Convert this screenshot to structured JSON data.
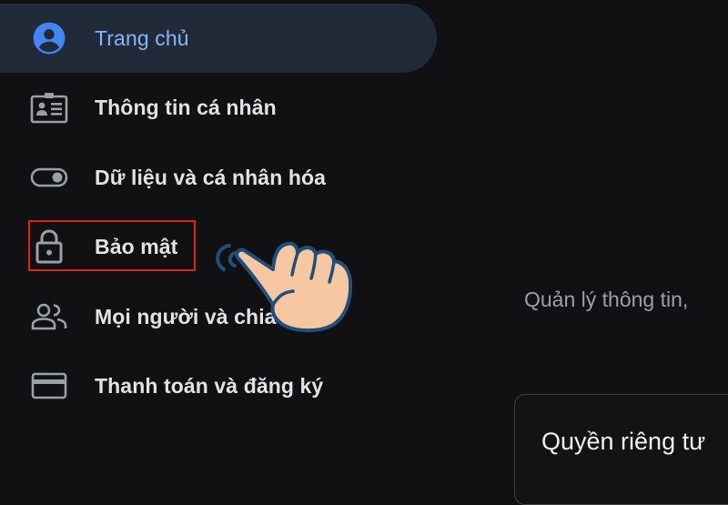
{
  "sidebar": {
    "items": [
      {
        "label": "Trang chủ",
        "icon": "account-circle-icon",
        "active": true
      },
      {
        "label": "Thông tin cá nhân",
        "icon": "id-card-icon",
        "active": false
      },
      {
        "label": "Dữ liệu và cá nhân hóa",
        "icon": "toggle-icon",
        "active": false
      },
      {
        "label": "Bảo mật",
        "icon": "lock-icon",
        "active": false,
        "highlighted": true
      },
      {
        "label": "Mọi người và chia sẻ",
        "icon": "people-icon",
        "active": false
      },
      {
        "label": "Thanh toán và đăng ký",
        "icon": "credit-card-icon",
        "active": false
      }
    ]
  },
  "main": {
    "subtitle": "Quản lý thông tin,",
    "privacy_card_title": "Quyền riêng tư"
  },
  "colors": {
    "background": "#111113",
    "active_item_bg": "#202a39",
    "active_text": "#8ab4f8",
    "active_icon": "#4285f4",
    "text": "#e2e2e2",
    "icon": "#9aa0a6",
    "highlight_border": "#e02020",
    "hand_fill": "#f6c7a1",
    "hand_outline": "#1f4f7c"
  }
}
